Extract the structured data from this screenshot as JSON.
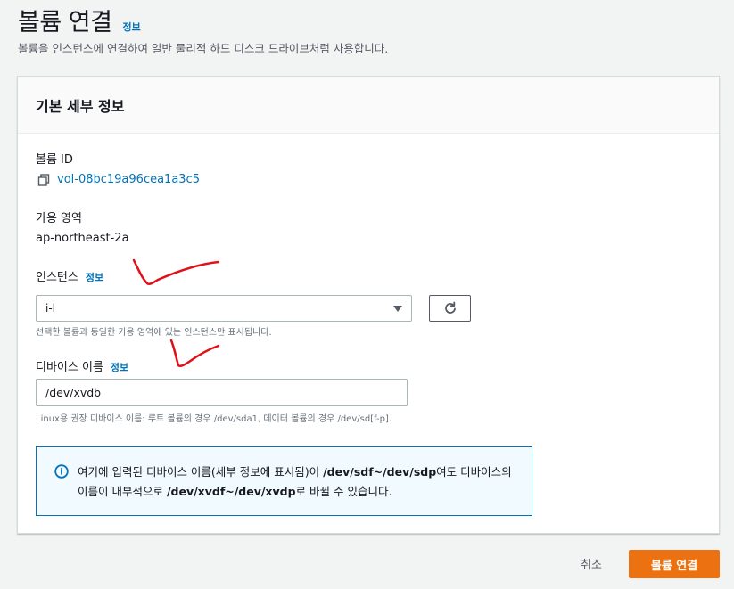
{
  "header": {
    "title": "볼륨 연결",
    "info_link": "정보",
    "description": "볼륨을 인스턴스에 연결하여 일반 물리적 하드 디스크 드라이브처럼 사용합니다."
  },
  "panel": {
    "title": "기본 세부 정보",
    "volume_id_label": "볼륨 ID",
    "volume_id_value": "vol-08bc19a96cea1a3c5",
    "az_label": "가용 영역",
    "az_value": "ap-northeast-2a",
    "instance_label": "인스턴스",
    "instance_info": "정보",
    "instance_select_value": "i-l",
    "instance_hint": "선택한 볼륨과 동일한 가용 영역에 있는 인스턴스만 표시됩니다.",
    "device_label": "디바이스 이름",
    "device_info": "정보",
    "device_value": "/dev/xvdb",
    "device_hint": "Linux용 권장 디바이스 이름: 루트 볼륨의 경우 /dev/sda1, 데이터 볼륨의 경우 /dev/sd[f-p].",
    "alert": {
      "part1": "여기에 입력된 디바이스 이름(세부 정보에 표시됨)이 ",
      "bold1": "/dev/sdf~/dev/sdp",
      "part2": "여도 디바이스의 이름이 내부적으로 ",
      "bold2": "/dev/xvdf~/dev/xvdp",
      "part3": "로 바뀔 수 있습니다."
    }
  },
  "footer": {
    "cancel_label": "취소",
    "submit_label": "볼륨 연결"
  },
  "colors": {
    "accent": "#ec7211",
    "link": "#0073bb",
    "annotation": "#e0101a"
  },
  "icons": [
    "copy-icon",
    "refresh-icon",
    "caret-down-icon",
    "info-icon"
  ]
}
